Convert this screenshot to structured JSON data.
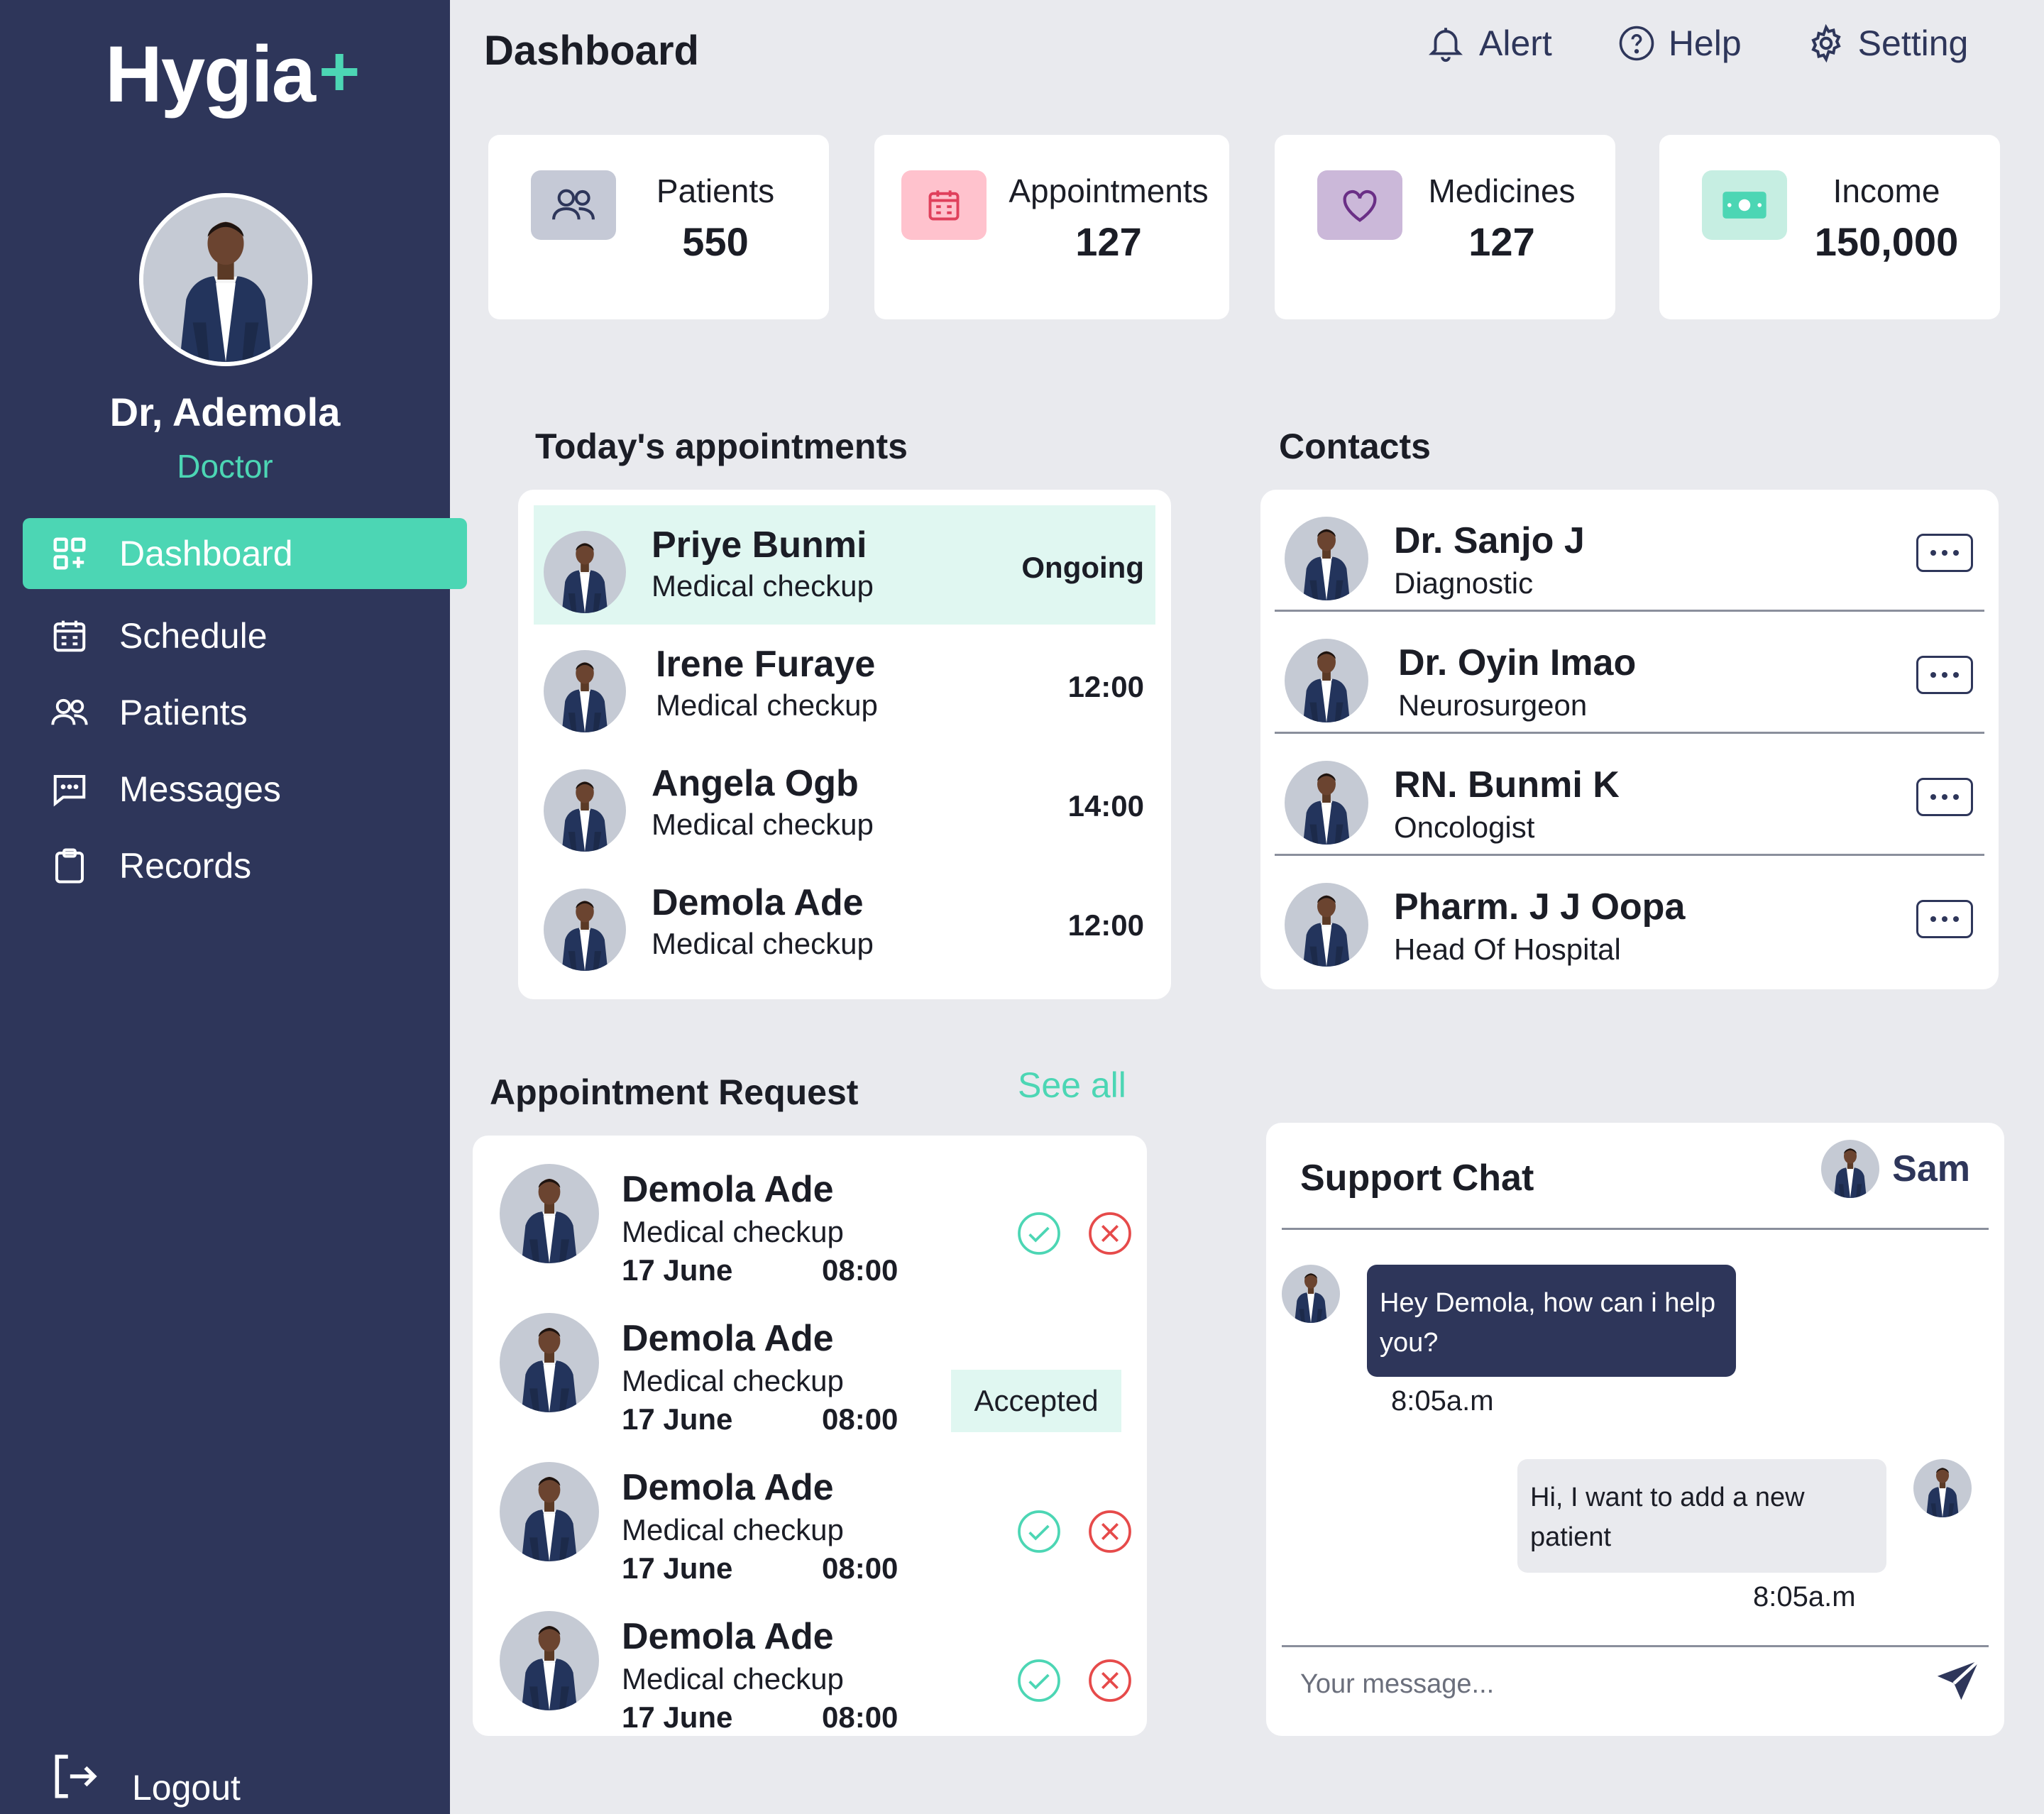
{
  "app": {
    "logo_text": "Hygia",
    "logo_plus": "+"
  },
  "profile": {
    "name": "Dr, Ademola",
    "role": "Doctor"
  },
  "sidebar": {
    "items": [
      {
        "label": "Dashboard",
        "icon": "grid-icon",
        "active": true
      },
      {
        "label": "Schedule",
        "icon": "calendar-icon"
      },
      {
        "label": "Patients",
        "icon": "users-icon"
      },
      {
        "label": "Messages",
        "icon": "message-icon"
      },
      {
        "label": "Records",
        "icon": "clipboard-icon"
      }
    ],
    "logout": "Logout"
  },
  "header": {
    "title": "Dashboard",
    "alert": "Alert",
    "help": "Help",
    "setting": "Setting"
  },
  "stats": [
    {
      "label": "Patients",
      "value": "550",
      "icon": "users-icon",
      "color": "#c5c9d6"
    },
    {
      "label": "Appointments",
      "value": "127",
      "icon": "calendar-icon",
      "color": "#ffc2cd"
    },
    {
      "label": "Medicines",
      "value": "127",
      "icon": "heart-icon",
      "color": "#cbb8d9"
    },
    {
      "label": "Income",
      "value": "150,000",
      "icon": "cash-icon",
      "color": "#c6eee2"
    }
  ],
  "today": {
    "title": "Today's appointments",
    "rows": [
      {
        "name": "Priye Bunmi",
        "type": "Medical checkup",
        "status": "Ongoing"
      },
      {
        "name": "Irene Furaye",
        "type": "Medical checkup",
        "status": "12:00"
      },
      {
        "name": "Angela Ogb",
        "type": "Medical checkup",
        "status": "14:00"
      },
      {
        "name": "Demola Ade",
        "type": "Medical checkup",
        "status": "12:00"
      }
    ]
  },
  "contacts": {
    "title": "Contacts",
    "rows": [
      {
        "name": "Dr. Sanjo J",
        "role": "Diagnostic"
      },
      {
        "name": "Dr. Oyin Imao",
        "role": "Neurosurgeon"
      },
      {
        "name": "RN. Bunmi K",
        "role": "Oncologist"
      },
      {
        "name": "Pharm. J J Oopa",
        "role": "Head Of Hospital"
      }
    ]
  },
  "requests": {
    "title": "Appointment Request",
    "see_all": "See all",
    "rows": [
      {
        "name": "Demola Ade",
        "type": "Medical checkup",
        "date": "17 June",
        "time": "08:00",
        "state": "pending"
      },
      {
        "name": "Demola Ade",
        "type": "Medical checkup",
        "date": "17 June",
        "time": "08:00",
        "state": "accepted",
        "state_label": "Accepted"
      },
      {
        "name": "Demola Ade",
        "type": "Medical checkup",
        "date": "17 June",
        "time": "08:00",
        "state": "pending"
      },
      {
        "name": "Demola Ade",
        "type": "Medical checkup",
        "date": "17 June",
        "time": "08:00",
        "state": "pending"
      }
    ]
  },
  "chat": {
    "title": "Support Chat",
    "user": "Sam",
    "messages": [
      {
        "text": "Hey Demola, how can i help you?",
        "time": "8:05a.m",
        "direction": "in"
      },
      {
        "text": "Hi, I want to add a new patient",
        "time": "8:05a.m",
        "direction": "out"
      }
    ],
    "placeholder": "Your message..."
  },
  "colors": {
    "sidebar": "#2e365a",
    "accent": "#4cd6b4",
    "accept": "#4cd6b4",
    "reject": "#e64a4a",
    "background": "#e9eaee"
  }
}
